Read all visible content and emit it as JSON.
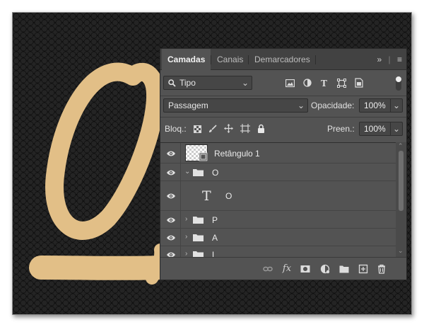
{
  "panel": {
    "tabs": [
      {
        "label": "Camadas",
        "active": true
      },
      {
        "label": "Canais",
        "active": false
      },
      {
        "label": "Demarcadores",
        "active": false
      }
    ],
    "collapse_glyph": "»",
    "menu_glyph": "≡",
    "filter": {
      "icon": "search-icon",
      "value": "Tipo",
      "filter_icons": [
        "image-filter-icon",
        "adjustment-filter-icon",
        "type-filter-icon",
        "shape-filter-icon",
        "smart-object-filter-icon"
      ],
      "type_glyph": "T"
    },
    "blend": {
      "mode": "Passagem",
      "opacity_label": "Opacidade:",
      "opacity_value": "100%"
    },
    "lock": {
      "label": "Bloq.:",
      "icons": [
        "lock-transparent-icon",
        "lock-paint-icon",
        "lock-move-icon",
        "lock-artboard-icon",
        "lock-all-icon"
      ],
      "fill_label": "Preen.:",
      "fill_value": "100%"
    },
    "layers": [
      {
        "name": "Retângulo 1",
        "kind": "shape",
        "visible": true
      },
      {
        "name": "O",
        "kind": "group",
        "expanded": true,
        "visible": true
      },
      {
        "name": "O",
        "kind": "text",
        "glyph": "T",
        "visible": true
      },
      {
        "name": "P",
        "kind": "group",
        "expanded": false,
        "visible": true
      },
      {
        "name": "A",
        "kind": "group",
        "expanded": false,
        "visible": true
      },
      {
        "name": "L",
        "kind": "group",
        "expanded": false,
        "visible": true
      }
    ],
    "bottom_icons": [
      "link-layers-icon",
      "fx-icon",
      "add-mask-icon",
      "adjustment-layer-icon",
      "new-group-icon",
      "new-layer-icon",
      "delete-layer-icon"
    ],
    "fx_label": "fx"
  },
  "colors": {
    "lettering": "#e2bf87",
    "panel_bg": "#535353",
    "tabbar_bg": "#424242"
  }
}
